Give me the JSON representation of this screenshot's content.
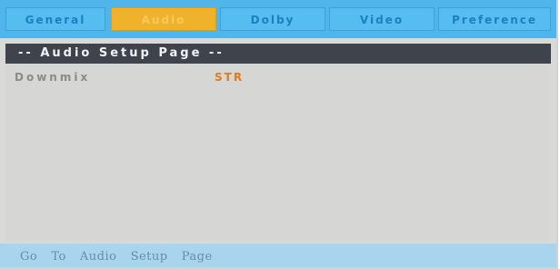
{
  "tabs": [
    {
      "label": "General",
      "active": false
    },
    {
      "label": "Audio",
      "active": true
    },
    {
      "label": "Dolby",
      "active": false
    },
    {
      "label": "Video",
      "active": false
    },
    {
      "label": "Preference",
      "active": false
    }
  ],
  "page": {
    "title": "-- Audio Setup Page --"
  },
  "settings": [
    {
      "label": "Downmix",
      "value": "STR"
    }
  ],
  "hints": [
    "Go",
    "To",
    "Audio",
    "Setup",
    "Page"
  ],
  "colors": {
    "tab_bar": "#4fb5ea",
    "active_tab": "#f1b22b",
    "header_bar": "#3f434b",
    "panel": "#d6d6d4",
    "value_text": "#e27a1c",
    "hint_bar": "#a9d4ee"
  }
}
